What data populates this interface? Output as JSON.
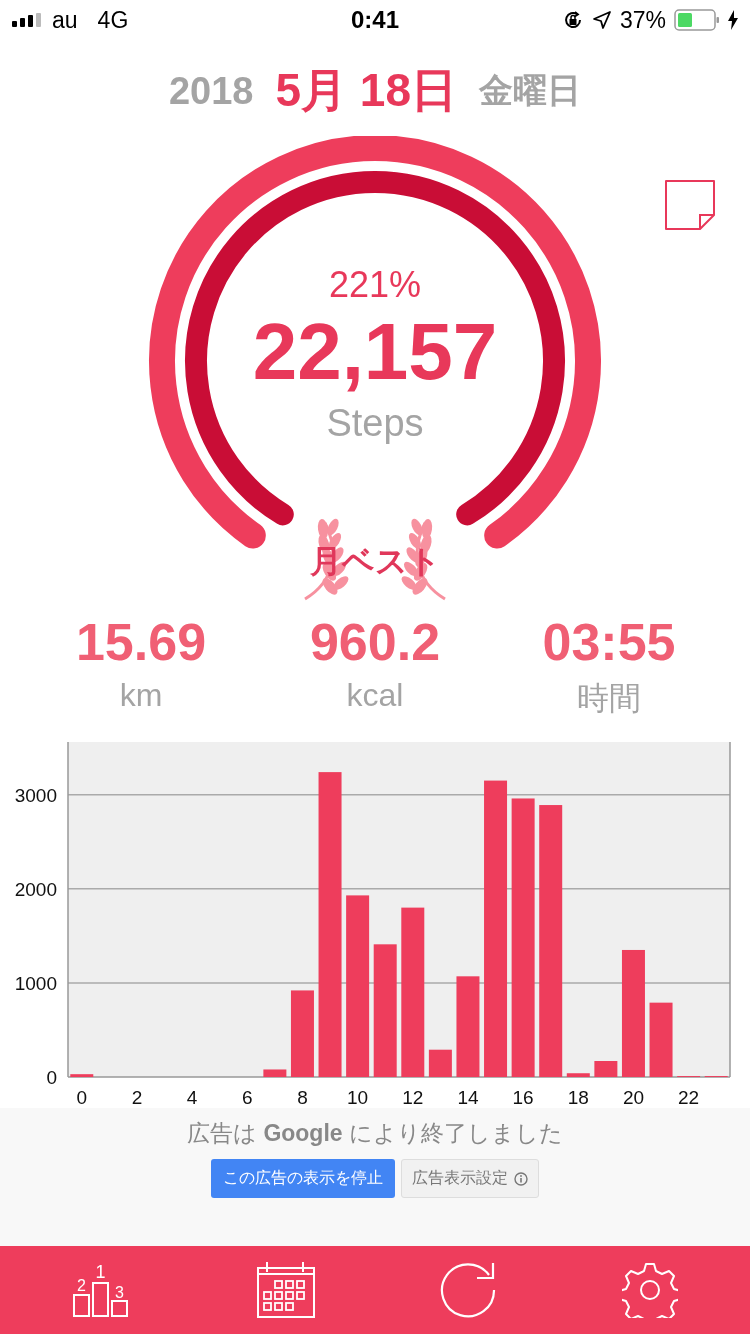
{
  "status_bar": {
    "carrier": "au",
    "network": "4G",
    "time": "0:41",
    "battery_text": "37%"
  },
  "date": {
    "year": "2018",
    "day": "5月 18日",
    "weekday": "金曜日"
  },
  "goal": {
    "percent": "221%",
    "steps": "22,157",
    "unit": "Steps",
    "badge": "月ベスト"
  },
  "metrics": [
    {
      "value": "15.69",
      "unit": "km"
    },
    {
      "value": "960.2",
      "unit": "kcal"
    },
    {
      "value": "03:55",
      "unit": "時間"
    }
  ],
  "hourly": {
    "chart_data": {
      "type": "bar",
      "x": [
        0,
        1,
        2,
        3,
        4,
        5,
        6,
        7,
        8,
        9,
        10,
        11,
        12,
        13,
        14,
        15,
        16,
        17,
        18,
        19,
        20,
        21,
        22,
        23
      ],
      "series": [
        {
          "color": "#ee3d5c",
          "values": [
            30,
            0,
            0,
            0,
            0,
            0,
            0,
            80,
            920,
            3240,
            1930,
            1410,
            1800,
            290,
            1070,
            3150,
            2960,
            2890,
            40,
            170,
            1350,
            790,
            10,
            10
          ]
        }
      ],
      "xlim": [
        -0.5,
        23.5
      ],
      "ylim": [
        0,
        3560
      ],
      "yticks": [
        0,
        1000,
        2000,
        3000
      ],
      "grid": true,
      "xticks": [
        0,
        2,
        4,
        6,
        8,
        10,
        12,
        14,
        16,
        18,
        20,
        22
      ]
    }
  },
  "ad": {
    "notice": "広告は **Google** により終了しました",
    "stop_button": "この広告の表示を停止",
    "settings_button": "広告表示設定"
  },
  "tab_bar": [
    {
      "kind": "ranking",
      "labels": [
        "1",
        "2",
        "3"
      ]
    },
    {
      "kind": "calendar"
    },
    {
      "kind": "refresh"
    },
    {
      "kind": "settings"
    }
  ]
}
